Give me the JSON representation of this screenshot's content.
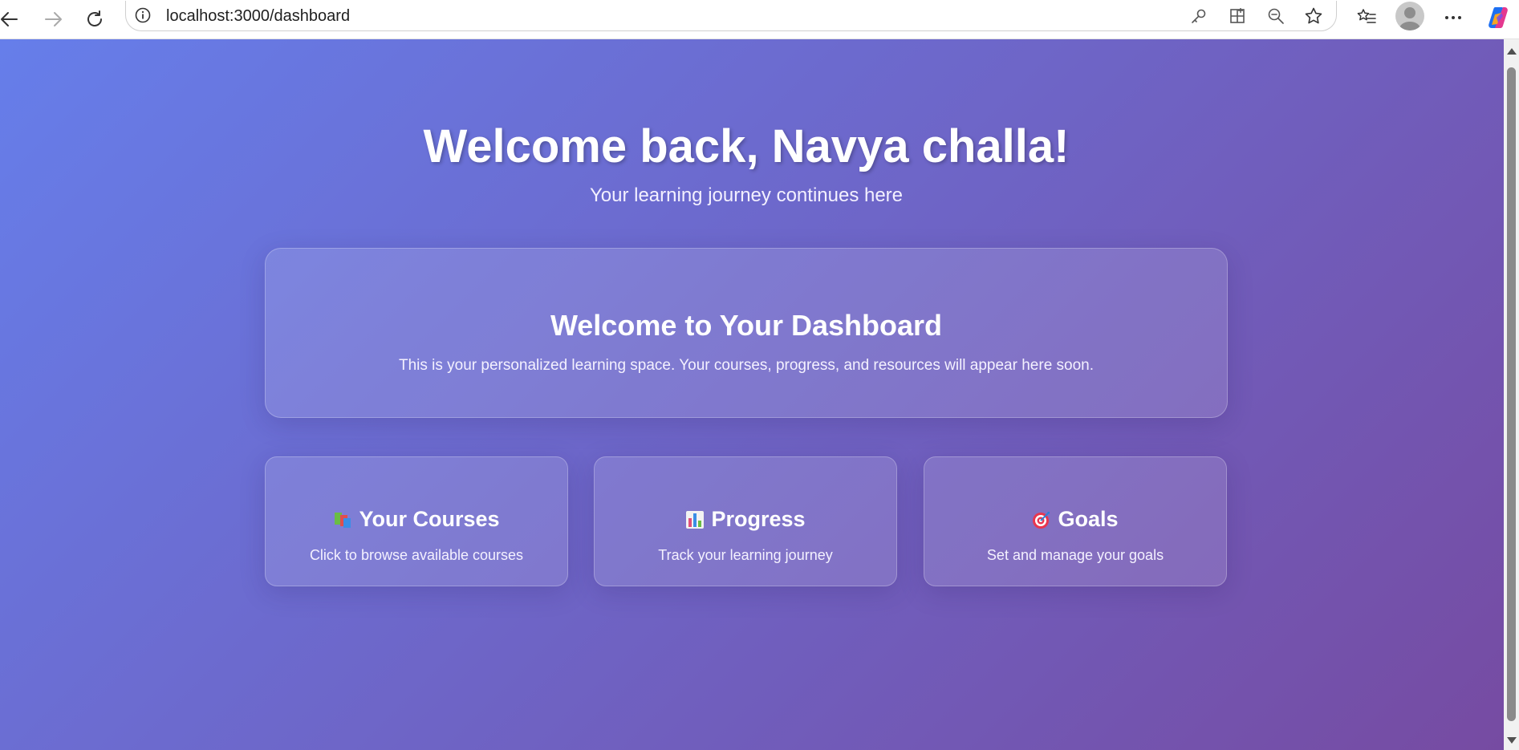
{
  "browser": {
    "url": "localhost:3000/dashboard",
    "icons": [
      "back-arrow-icon",
      "forward-arrow-icon",
      "refresh-icon",
      "info-icon",
      "key-icon",
      "app-grid-icon",
      "zoom-out-icon",
      "star-icon",
      "favorites-icon",
      "profile-avatar",
      "more-icon",
      "copilot-icon"
    ]
  },
  "header": {
    "title": "Welcome back, Navya challa!",
    "subtitle": "Your learning journey continues here"
  },
  "welcome_card": {
    "title": "Welcome to Your Dashboard",
    "text": "This is your personalized learning space. Your courses, progress, and resources will appear here soon."
  },
  "cards": [
    {
      "icon": "books-icon",
      "title": "Your Courses",
      "description": "Click to browse available courses"
    },
    {
      "icon": "bar-chart-icon",
      "title": "Progress",
      "description": "Track your learning journey"
    },
    {
      "icon": "target-icon",
      "title": "Goals",
      "description": "Set and manage your goals"
    }
  ],
  "colors": {
    "gradient_start": "#667eea",
    "gradient_end": "#764ba2"
  }
}
